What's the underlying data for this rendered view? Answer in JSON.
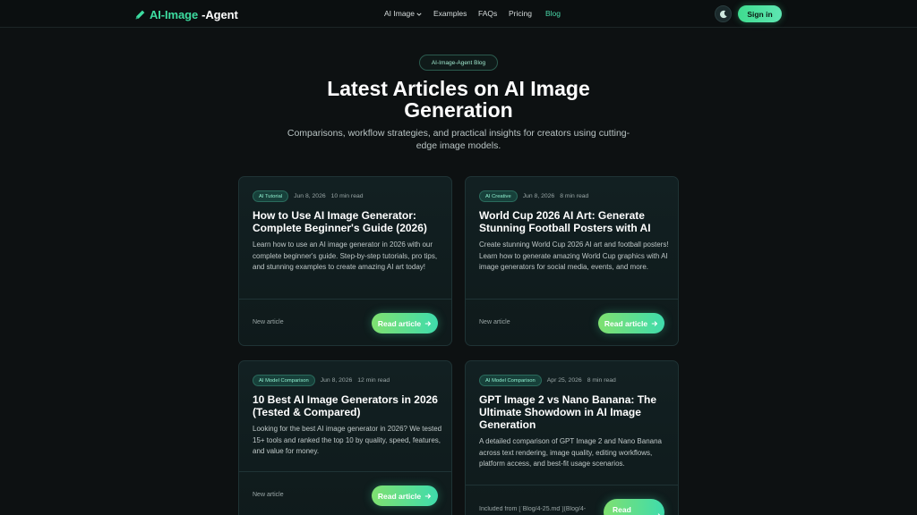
{
  "brand": {
    "name_accent": "AI-Image",
    "name_rest": "-Agent"
  },
  "nav": {
    "items": [
      {
        "label": "AI Image",
        "has_dropdown": true
      },
      {
        "label": "Examples"
      },
      {
        "label": "FAQs"
      },
      {
        "label": "Pricing"
      },
      {
        "label": "Blog",
        "active": true
      }
    ],
    "signin_label": "Sign in"
  },
  "hero": {
    "pill": "AI-Image-Agent Blog",
    "title": "Latest Articles on AI Image Generation",
    "subtitle": "Comparisons, workflow strategies, and practical insights for creators using cutting-edge image models."
  },
  "cards": [
    {
      "badge": "AI Tutorial",
      "date": "Jun 8, 2026",
      "read_time": "10 min read",
      "title": "How to Use AI Image Generator: Complete Beginner's Guide (2026)",
      "description": "Learn how to use an AI image generator in 2026 with our complete beginner's guide. Step-by-step tutorials, pro tips, and stunning examples to create amazing AI art today!",
      "footnote": "New article",
      "button": "Read article"
    },
    {
      "badge": "AI Creative",
      "date": "Jun 8, 2026",
      "read_time": "8 min read",
      "title": "World Cup 2026 AI Art: Generate Stunning Football Posters with AI",
      "description": "Create stunning World Cup 2026 AI art and football posters! Learn how to generate amazing World Cup graphics with AI image generators for social media, events, and more.",
      "footnote": "New article",
      "button": "Read article"
    },
    {
      "badge": "AI Model Comparison",
      "date": "Jun 8, 2026",
      "read_time": "12 min read",
      "title": "10 Best AI Image Generators in 2026 (Tested & Compared)",
      "description": "Looking for the best AI image generator in 2026? We tested 15+ tools and ranked the top 10 by quality, speed, features, and value for money.",
      "footnote": "New article",
      "button": "Read article"
    },
    {
      "badge": "AI Model Comparison",
      "date": "Apr 25, 2026",
      "read_time": "8 min read",
      "title": "GPT Image 2 vs Nano Banana: The Ultimate Showdown in AI Image Generation",
      "description": "A detailed comparison of GPT Image 2 and Nano Banana across text rendering, image quality, editing workflows, platform access, and best-fit usage scenarios.",
      "footnote": "Included from [`Blog/4-25.md`](Blog/4-",
      "button": "Read"
    }
  ],
  "colors": {
    "accent": "#3ddca0",
    "background": "#0d1112",
    "card": "#122022"
  }
}
